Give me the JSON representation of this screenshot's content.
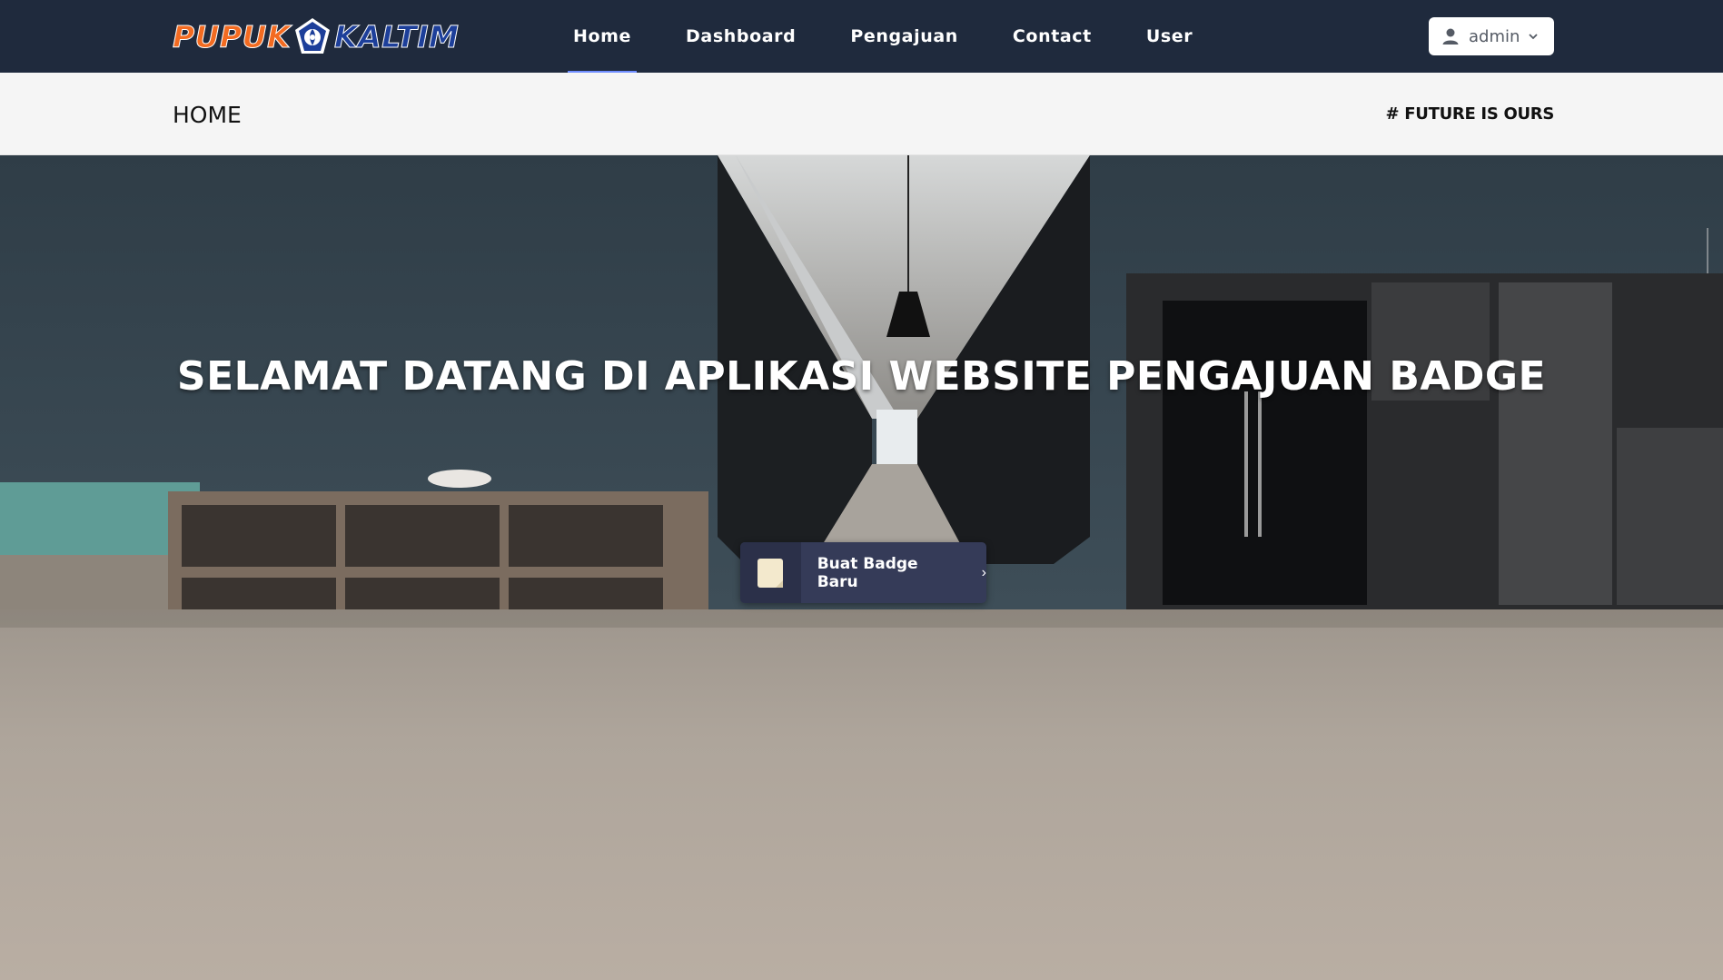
{
  "brand": {
    "part1": "PUPUK",
    "part2": "KALTIM",
    "logo_icon": "pupuk-kaltim-emblem",
    "orange": "#f36b21",
    "blue": "#1d3f9a"
  },
  "nav": {
    "items": [
      {
        "label": "Home",
        "active": true
      },
      {
        "label": "Dashboard",
        "active": false
      },
      {
        "label": "Pengajuan",
        "active": false
      },
      {
        "label": "Contact",
        "active": false
      },
      {
        "label": "User",
        "active": false
      }
    ],
    "active_color": "#6f8dff"
  },
  "user_menu": {
    "username": "admin",
    "icon": "user-icon",
    "caret": "chevron-down-icon"
  },
  "subheader": {
    "title": "HOME",
    "tagline": "# FUTURE IS OURS"
  },
  "hero": {
    "title": "SELAMAT DATANG DI APLIKASI WEBSITE PENGAJUAN BADGE",
    "cta_label": "Buat Badge Baru",
    "cta_icon": "note-icon",
    "cta_arrow": "›"
  },
  "colors": {
    "navbar": "#1f2a3d",
    "subheader": "#f5f5f5",
    "cta": "#353b58"
  }
}
